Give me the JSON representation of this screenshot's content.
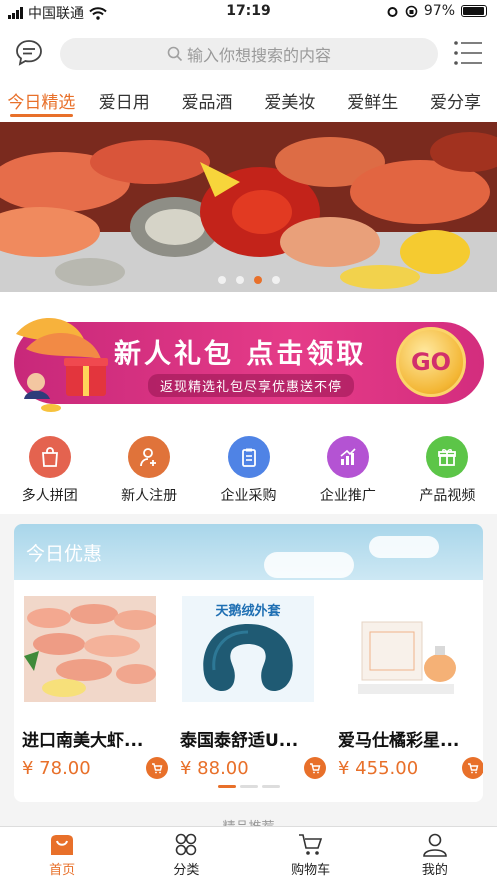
{
  "status_bar": {
    "carrier": "中国联通",
    "time": "17:19",
    "battery": "97%",
    "battery_level": 0.97,
    "signal_bars": 4
  },
  "header": {
    "search_placeholder": "输入你想搜索的内容",
    "icons": [
      "message-icon",
      "search-icon",
      "menu-icon"
    ]
  },
  "tabs": [
    {
      "label": "今日精选",
      "active": true
    },
    {
      "label": "爱日用"
    },
    {
      "label": "爱品酒"
    },
    {
      "label": "爱美妆"
    },
    {
      "label": "爱鲜生"
    },
    {
      "label": "爱分享"
    }
  ],
  "hero": {
    "slides": 4,
    "active_slide": 3
  },
  "promo": {
    "title": "新人礼包 点击领取",
    "subtitle": "返现精选礼包尽享优惠送不停",
    "go_label": "GO"
  },
  "quick_links": [
    {
      "label": "多人拼团",
      "icon": "shopping-bag-icon",
      "color": "#e4634f"
    },
    {
      "label": "新人注册",
      "icon": "user-add-icon",
      "color": "#e0733a"
    },
    {
      "label": "企业采购",
      "icon": "clipboard-icon",
      "color": "#4f83e5"
    },
    {
      "label": "企业推广",
      "icon": "bar-chart-icon",
      "color": "#b453d3"
    },
    {
      "label": "产品视频",
      "icon": "gift-icon",
      "color": "#5cc548"
    }
  ],
  "deals": {
    "title": "今日优惠",
    "products": [
      {
        "name": "进口南美大虾...",
        "price": "¥ 78.00"
      },
      {
        "name": "泰国泰舒适U...",
        "price": "¥ 88.00",
        "image_text": "天鹅绒外套"
      },
      {
        "name": "爱马仕橘彩星...",
        "price": "¥ 455.00"
      }
    ],
    "pages": 3,
    "active_page": 1
  },
  "next_section_peek": "精品推荐",
  "bottom_nav": [
    {
      "label": "首页",
      "icon": "home-icon",
      "active": true
    },
    {
      "label": "分类",
      "icon": "category-icon"
    },
    {
      "label": "购物车",
      "icon": "cart-icon"
    },
    {
      "label": "我的",
      "icon": "profile-icon"
    }
  ],
  "colors": {
    "accent": "#e8702a",
    "promo_pink": "#e53b88"
  }
}
